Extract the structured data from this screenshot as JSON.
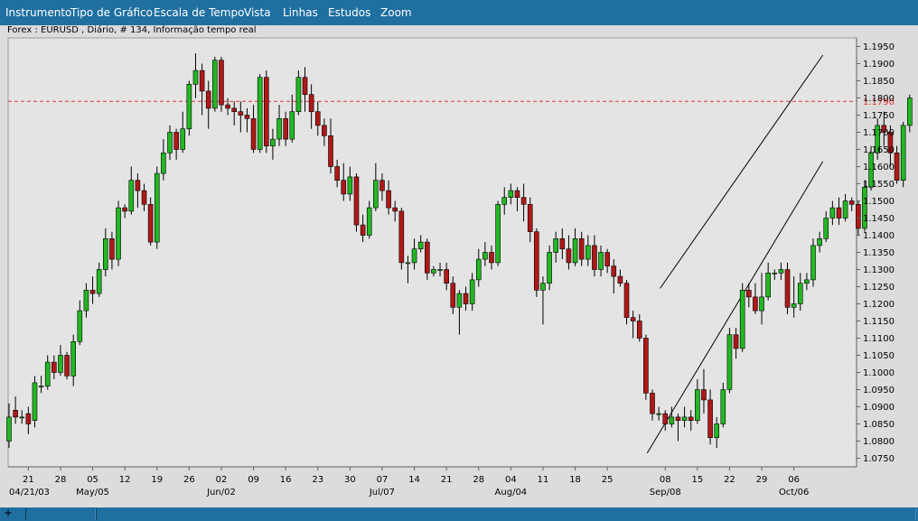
{
  "menu": {
    "items": [
      "Instrumento",
      "Tipo de Gráfico",
      "Escala de Tempo",
      "Vista",
      "Linhas",
      "Estudos",
      "Zoom"
    ]
  },
  "subtitle": "Forex : EURUSD , Diário, # 134, Informação tempo real",
  "colors": {
    "up": "#22b822",
    "down": "#b01818",
    "hline": "#e03030",
    "menu": "#1f6fa0",
    "plot_bg": "#e4e4e4"
  },
  "chart_data": {
    "type": "candlestick",
    "symbol": "EURUSD",
    "timeframe": "Diário",
    "ylim": [
      1.0725,
      1.1975
    ],
    "y_ticks": [
      "1.1950",
      "1.1900",
      "1.1850",
      "1.1800",
      "1.1750",
      "1.1700",
      "1.1650",
      "1.1600",
      "1.1550",
      "1.1500",
      "1.1450",
      "1.1400",
      "1.1350",
      "1.1300",
      "1.1250",
      "1.1200",
      "1.1150",
      "1.1100",
      "1.1050",
      "1.1000",
      "1.0950",
      "1.0900",
      "1.0850",
      "1.0800",
      "1.0750"
    ],
    "horizontal_line": {
      "value": 1.179,
      "label": "1.1790"
    },
    "x_ticks": [
      {
        "i": 3,
        "label": "21"
      },
      {
        "i": 8,
        "label": "28"
      },
      {
        "i": 13,
        "label": "05"
      },
      {
        "i": 18,
        "label": "12"
      },
      {
        "i": 23,
        "label": "19"
      },
      {
        "i": 28,
        "label": "26"
      },
      {
        "i": 33,
        "label": "02"
      },
      {
        "i": 38,
        "label": "09"
      },
      {
        "i": 43,
        "label": "16"
      },
      {
        "i": 48,
        "label": "23"
      },
      {
        "i": 53,
        "label": "30"
      },
      {
        "i": 58,
        "label": "07"
      },
      {
        "i": 63,
        "label": "14"
      },
      {
        "i": 68,
        "label": "21"
      },
      {
        "i": 73,
        "label": "28"
      },
      {
        "i": 78,
        "label": "04"
      },
      {
        "i": 83,
        "label": "11"
      },
      {
        "i": 88,
        "label": "18"
      },
      {
        "i": 93,
        "label": "25"
      },
      {
        "i": 102,
        "label": "08"
      },
      {
        "i": 107,
        "label": "15"
      },
      {
        "i": 112,
        "label": "22"
      },
      {
        "i": 117,
        "label": "29"
      },
      {
        "i": 122,
        "label": "06"
      }
    ],
    "x_month_labels": [
      {
        "i": 0,
        "label": "04/21/03"
      },
      {
        "i": 13,
        "label": "May/05"
      },
      {
        "i": 33,
        "label": "Jun/02"
      },
      {
        "i": 58,
        "label": "Jul/07"
      },
      {
        "i": 78,
        "label": "Aug/04"
      },
      {
        "i": 102,
        "label": "Sep/08"
      },
      {
        "i": 122,
        "label": "Oct/06"
      }
    ],
    "trendlines": [
      {
        "from": {
          "i": 101.2,
          "y": 1.1245
        },
        "to": {
          "i": 126.5,
          "y": 1.1925
        }
      },
      {
        "from": {
          "i": 99.2,
          "y": 1.0765
        },
        "to": {
          "i": 126.5,
          "y": 1.1615
        }
      }
    ],
    "candles": [
      [
        1.08,
        1.087,
        1.078,
        1.091
      ],
      [
        1.089,
        1.087,
        1.085,
        1.093
      ],
      [
        1.087,
        1.087,
        1.085,
        1.089
      ],
      [
        1.088,
        1.085,
        1.082,
        1.09
      ],
      [
        1.086,
        1.097,
        1.084,
        1.099
      ],
      [
        1.096,
        1.096,
        1.094,
        1.099
      ],
      [
        1.096,
        1.103,
        1.095,
        1.105
      ],
      [
        1.103,
        1.1,
        1.098,
        1.105
      ],
      [
        1.1,
        1.105,
        1.099,
        1.108
      ],
      [
        1.105,
        1.099,
        1.098,
        1.106
      ],
      [
        1.099,
        1.109,
        1.096,
        1.111
      ],
      [
        1.109,
        1.118,
        1.108,
        1.121
      ],
      [
        1.118,
        1.124,
        1.116,
        1.126
      ],
      [
        1.124,
        1.123,
        1.12,
        1.128
      ],
      [
        1.123,
        1.13,
        1.122,
        1.132
      ],
      [
        1.13,
        1.139,
        1.128,
        1.142
      ],
      [
        1.139,
        1.133,
        1.13,
        1.141
      ],
      [
        1.133,
        1.148,
        1.131,
        1.15
      ],
      [
        1.148,
        1.147,
        1.145,
        1.149
      ],
      [
        1.147,
        1.156,
        1.146,
        1.16
      ],
      [
        1.156,
        1.153,
        1.148,
        1.158
      ],
      [
        1.153,
        1.149,
        1.147,
        1.155
      ],
      [
        1.149,
        1.138,
        1.137,
        1.151
      ],
      [
        1.138,
        1.158,
        1.136,
        1.16
      ],
      [
        1.158,
        1.164,
        1.156,
        1.168
      ],
      [
        1.164,
        1.17,
        1.162,
        1.172
      ],
      [
        1.17,
        1.165,
        1.162,
        1.171
      ],
      [
        1.165,
        1.171,
        1.164,
        1.176
      ],
      [
        1.171,
        1.184,
        1.169,
        1.185
      ],
      [
        1.184,
        1.188,
        1.18,
        1.193
      ],
      [
        1.188,
        1.182,
        1.175,
        1.19
      ],
      [
        1.182,
        1.177,
        1.171,
        1.185
      ],
      [
        1.177,
        1.191,
        1.176,
        1.192
      ],
      [
        1.191,
        1.178,
        1.176,
        1.192
      ],
      [
        1.178,
        1.177,
        1.175,
        1.18
      ],
      [
        1.177,
        1.176,
        1.172,
        1.179
      ],
      [
        1.176,
        1.175,
        1.17,
        1.179
      ],
      [
        1.175,
        1.174,
        1.17,
        1.177
      ],
      [
        1.174,
        1.165,
        1.164,
        1.178
      ],
      [
        1.165,
        1.186,
        1.164,
        1.187
      ],
      [
        1.186,
        1.166,
        1.164,
        1.188
      ],
      [
        1.166,
        1.168,
        1.162,
        1.171
      ],
      [
        1.168,
        1.174,
        1.166,
        1.178
      ],
      [
        1.174,
        1.168,
        1.166,
        1.176
      ],
      [
        1.168,
        1.176,
        1.167,
        1.181
      ],
      [
        1.176,
        1.186,
        1.175,
        1.188
      ],
      [
        1.186,
        1.181,
        1.176,
        1.189
      ],
      [
        1.181,
        1.176,
        1.171,
        1.184
      ],
      [
        1.176,
        1.172,
        1.169,
        1.179
      ],
      [
        1.172,
        1.169,
        1.166,
        1.174
      ],
      [
        1.169,
        1.16,
        1.158,
        1.174
      ],
      [
        1.16,
        1.156,
        1.154,
        1.162
      ],
      [
        1.156,
        1.152,
        1.15,
        1.161
      ],
      [
        1.152,
        1.157,
        1.15,
        1.16
      ],
      [
        1.157,
        1.143,
        1.141,
        1.158
      ],
      [
        1.143,
        1.14,
        1.138,
        1.146
      ],
      [
        1.14,
        1.148,
        1.139,
        1.15
      ],
      [
        1.148,
        1.156,
        1.147,
        1.161
      ],
      [
        1.156,
        1.153,
        1.15,
        1.158
      ],
      [
        1.153,
        1.148,
        1.146,
        1.156
      ],
      [
        1.148,
        1.147,
        1.144,
        1.15
      ],
      [
        1.147,
        1.132,
        1.13,
        1.148
      ],
      [
        1.132,
        1.132,
        1.126,
        1.134
      ],
      [
        1.132,
        1.136,
        1.13,
        1.139
      ],
      [
        1.136,
        1.138,
        1.135,
        1.14
      ],
      [
        1.138,
        1.129,
        1.127,
        1.139
      ],
      [
        1.129,
        1.13,
        1.128,
        1.131
      ],
      [
        1.13,
        1.13,
        1.128,
        1.132
      ],
      [
        1.13,
        1.126,
        1.124,
        1.132
      ],
      [
        1.126,
        1.119,
        1.117,
        1.128
      ],
      [
        1.119,
        1.123,
        1.111,
        1.124
      ],
      [
        1.123,
        1.12,
        1.118,
        1.125
      ],
      [
        1.12,
        1.127,
        1.118,
        1.129
      ],
      [
        1.127,
        1.133,
        1.125,
        1.136
      ],
      [
        1.133,
        1.135,
        1.131,
        1.138
      ],
      [
        1.135,
        1.132,
        1.13,
        1.137
      ],
      [
        1.132,
        1.149,
        1.131,
        1.15
      ],
      [
        1.149,
        1.151,
        1.146,
        1.154
      ],
      [
        1.151,
        1.153,
        1.149,
        1.155
      ],
      [
        1.153,
        1.151,
        1.147,
        1.154
      ],
      [
        1.151,
        1.149,
        1.144,
        1.155
      ],
      [
        1.149,
        1.141,
        1.138,
        1.151
      ],
      [
        1.141,
        1.124,
        1.122,
        1.142
      ],
      [
        1.124,
        1.126,
        1.114,
        1.128
      ],
      [
        1.126,
        1.135,
        1.124,
        1.137
      ],
      [
        1.135,
        1.139,
        1.132,
        1.141
      ],
      [
        1.139,
        1.136,
        1.133,
        1.142
      ],
      [
        1.136,
        1.132,
        1.13,
        1.14
      ],
      [
        1.132,
        1.139,
        1.131,
        1.142
      ],
      [
        1.139,
        1.133,
        1.131,
        1.141
      ],
      [
        1.133,
        1.137,
        1.131,
        1.14
      ],
      [
        1.137,
        1.13,
        1.128,
        1.14
      ],
      [
        1.13,
        1.135,
        1.128,
        1.137
      ],
      [
        1.135,
        1.131,
        1.129,
        1.136
      ],
      [
        1.131,
        1.128,
        1.123,
        1.133
      ],
      [
        1.128,
        1.126,
        1.125,
        1.13
      ],
      [
        1.126,
        1.116,
        1.114,
        1.127
      ],
      [
        1.116,
        1.115,
        1.11,
        1.118
      ],
      [
        1.115,
        1.11,
        1.109,
        1.117
      ],
      [
        1.11,
        1.094,
        1.092,
        1.111
      ],
      [
        1.094,
        1.088,
        1.086,
        1.095
      ],
      [
        1.088,
        1.088,
        1.086,
        1.09
      ],
      [
        1.088,
        1.085,
        1.083,
        1.089
      ],
      [
        1.085,
        1.087,
        1.084,
        1.09
      ],
      [
        1.087,
        1.086,
        1.08,
        1.088
      ],
      [
        1.086,
        1.087,
        1.084,
        1.09
      ],
      [
        1.087,
        1.086,
        1.083,
        1.089
      ],
      [
        1.086,
        1.095,
        1.085,
        1.098
      ],
      [
        1.095,
        1.092,
        1.088,
        1.101
      ],
      [
        1.092,
        1.081,
        1.079,
        1.095
      ],
      [
        1.081,
        1.085,
        1.078,
        1.087
      ],
      [
        1.085,
        1.095,
        1.084,
        1.097
      ],
      [
        1.095,
        1.111,
        1.094,
        1.113
      ],
      [
        1.111,
        1.107,
        1.104,
        1.113
      ],
      [
        1.107,
        1.124,
        1.106,
        1.126
      ],
      [
        1.124,
        1.122,
        1.119,
        1.126
      ],
      [
        1.122,
        1.118,
        1.117,
        1.126
      ],
      [
        1.118,
        1.122,
        1.114,
        1.129
      ],
      [
        1.122,
        1.129,
        1.121,
        1.132
      ],
      [
        1.129,
        1.129,
        1.127,
        1.13
      ],
      [
        1.129,
        1.13,
        1.127,
        1.132
      ],
      [
        1.13,
        1.119,
        1.117,
        1.132
      ],
      [
        1.119,
        1.12,
        1.116,
        1.128
      ],
      [
        1.12,
        1.126,
        1.118,
        1.129
      ],
      [
        1.126,
        1.127,
        1.124,
        1.129
      ],
      [
        1.127,
        1.137,
        1.125,
        1.139
      ],
      [
        1.137,
        1.139,
        1.135,
        1.141
      ],
      [
        1.139,
        1.145,
        1.138,
        1.147
      ],
      [
        1.145,
        1.148,
        1.143,
        1.15
      ],
      [
        1.148,
        1.145,
        1.143,
        1.151
      ],
      [
        1.145,
        1.15,
        1.144,
        1.152
      ],
      [
        1.15,
        1.149,
        1.147,
        1.151
      ],
      [
        1.149,
        1.142,
        1.14,
        1.15
      ],
      [
        1.142,
        1.154,
        1.141,
        1.156
      ],
      [
        1.154,
        1.164,
        1.153,
        1.166
      ],
      [
        1.164,
        1.172,
        1.162,
        1.174
      ],
      [
        1.172,
        1.17,
        1.166,
        1.176
      ],
      [
        1.17,
        1.164,
        1.16,
        1.172
      ],
      [
        1.164,
        1.156,
        1.155,
        1.166
      ],
      [
        1.156,
        1.172,
        1.154,
        1.173
      ],
      [
        1.172,
        1.18,
        1.17,
        1.181
      ]
    ]
  }
}
